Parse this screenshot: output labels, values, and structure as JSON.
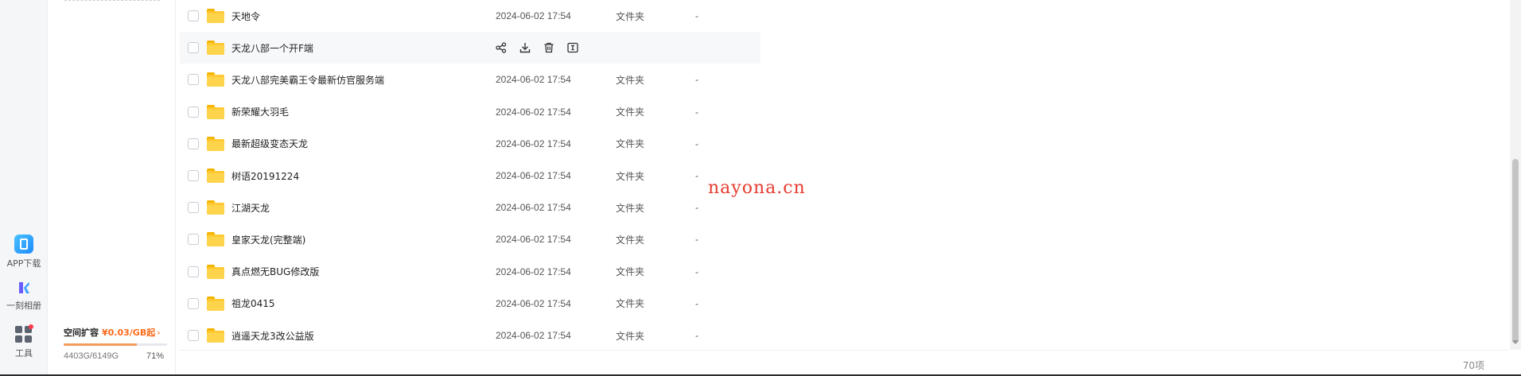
{
  "rail": {
    "app_download": "APP下载",
    "album": "一刻相册",
    "tools": "工具"
  },
  "quota": {
    "title": "空间扩容",
    "price": "¥0.03/GB起",
    "used": "4403G/6149G",
    "percent_label": "71%",
    "percent_value": 0.71
  },
  "files": [
    {
      "name": "天地令",
      "date": "2024-06-02 17:54",
      "type": "文件夹",
      "size": "-"
    },
    {
      "name": "天龙八部一个开F端",
      "date": "",
      "type": "",
      "size": "",
      "hover": true
    },
    {
      "name": "天龙八部完美霸王令最新仿官服务端",
      "date": "2024-06-02 17:54",
      "type": "文件夹",
      "size": "-"
    },
    {
      "name": "新荣耀大羽毛",
      "date": "2024-06-02 17:54",
      "type": "文件夹",
      "size": "-"
    },
    {
      "name": "最新超级变态天龙",
      "date": "2024-06-02 17:54",
      "type": "文件夹",
      "size": "-"
    },
    {
      "name": "树语20191224",
      "date": "2024-06-02 17:54",
      "type": "文件夹",
      "size": "-"
    },
    {
      "name": "江湖天龙",
      "date": "2024-06-02 17:54",
      "type": "文件夹",
      "size": "-"
    },
    {
      "name": "皇家天龙(完整端)",
      "date": "2024-06-02 17:54",
      "type": "文件夹",
      "size": "-"
    },
    {
      "name": "真点燃无BUG修改版",
      "date": "2024-06-02 17:54",
      "type": "文件夹",
      "size": "-"
    },
    {
      "name": "祖龙0415",
      "date": "2024-06-02 17:54",
      "type": "文件夹",
      "size": "-"
    },
    {
      "name": "逍遥天龙3改公益版",
      "date": "2024-06-02 17:54",
      "type": "文件夹",
      "size": "-"
    }
  ],
  "watermark": "nayona.cn",
  "footer": {
    "count": "70项"
  }
}
